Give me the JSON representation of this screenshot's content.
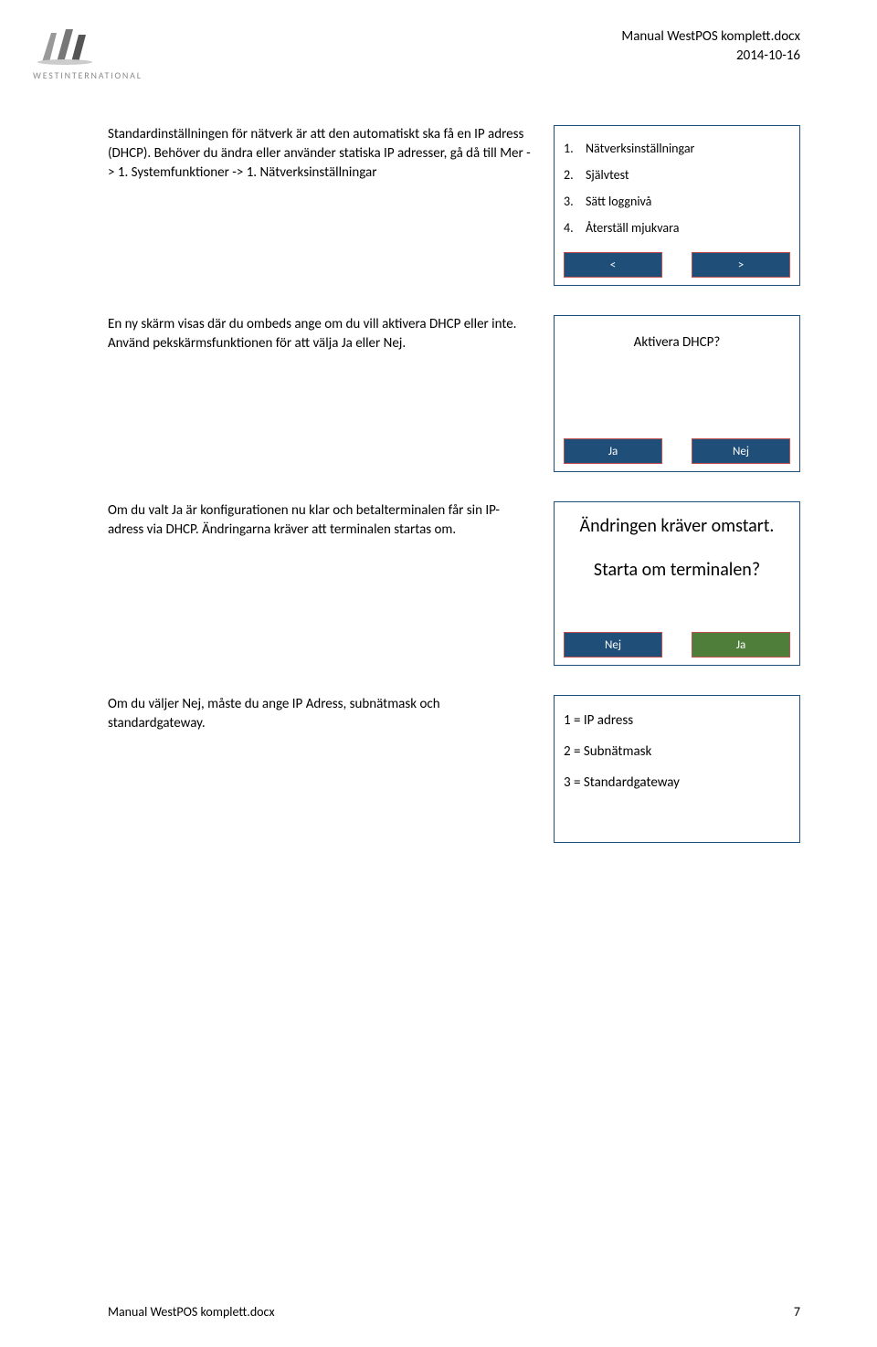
{
  "header": {
    "logo_text": "WESTINTERNATIONAL",
    "doc_title": "Manual WestPOS komplett.docx",
    "doc_date": "2014-10-16"
  },
  "section1": {
    "text": "Standardinställningen för nätverk är att den automatiskt ska få en IP adress (DHCP). Behöver du ändra eller använder statiska IP adresser, gå då till Mer -> 1. Systemfunktioner -> 1. Nätverksinställningar",
    "items": [
      {
        "num": "1.",
        "label": "Nätverksinställningar"
      },
      {
        "num": "2.",
        "label": "Självtest"
      },
      {
        "num": "3.",
        "label": "Sätt loggnivå"
      },
      {
        "num": "4.",
        "label": "Återställ mjukvara"
      }
    ],
    "btn_prev": "<",
    "btn_next": ">"
  },
  "section2": {
    "text": "En ny skärm visas där du ombeds ange om du vill aktivera DHCP eller inte. Använd pekskärmsfunktionen för att välja Ja eller Nej.",
    "prompt": "Aktivera DHCP?",
    "btn_yes": "Ja",
    "btn_no": "Nej"
  },
  "section3": {
    "text": "Om du valt Ja är konfigurationen nu klar och betalterminalen får sin IP-adress via DHCP. Ändringarna kräver att terminalen startas om.",
    "line1": "Ändringen kräver omstart.",
    "line2": "Starta om terminalen?",
    "btn_no": "Nej",
    "btn_yes": "Ja"
  },
  "section4": {
    "text": "Om du väljer Nej, måste du ange IP Adress, subnätmask och standardgateway.",
    "options": [
      "1 = IP adress",
      "2 = Subnätmask",
      "3 = Standardgateway"
    ]
  },
  "footer": {
    "left": "Manual WestPOS komplett.docx",
    "right": "7"
  }
}
